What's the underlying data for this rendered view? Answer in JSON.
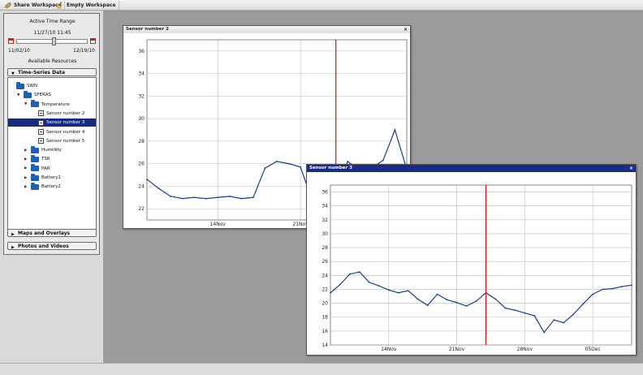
{
  "toolbar": {
    "share_label": "Share Workspace",
    "empty_label": "Empty Workspace"
  },
  "time_range": {
    "title": "Active Time Range",
    "current": "11/27/10 11:45",
    "min": "11/02/10",
    "max": "12/19/10",
    "position_fraction": 0.53
  },
  "resources": {
    "title": "Available Resources",
    "sections": [
      "Time-Series Data",
      "Maps and Overlays",
      "Photos and Videos"
    ],
    "tree": [
      {
        "label": "SWN",
        "level": 0,
        "kind": "folder",
        "expanded": true
      },
      {
        "label": "SFERAS",
        "level": 1,
        "kind": "folder",
        "expanded": true
      },
      {
        "label": "Temperature",
        "level": 2,
        "kind": "folder",
        "expanded": true
      },
      {
        "label": "Sensor number 2",
        "level": 3,
        "kind": "sensor"
      },
      {
        "label": "Sensor number 3",
        "level": 3,
        "kind": "sensor",
        "selected": true
      },
      {
        "label": "Sensor number 4",
        "level": 3,
        "kind": "sensor"
      },
      {
        "label": "Sensor number 5",
        "level": 3,
        "kind": "sensor"
      },
      {
        "label": "Humidity",
        "level": 2,
        "kind": "folder"
      },
      {
        "label": "TSR",
        "level": 2,
        "kind": "folder"
      },
      {
        "label": "PAR",
        "level": 2,
        "kind": "folder"
      },
      {
        "label": "Battery1",
        "level": 2,
        "kind": "folder"
      },
      {
        "label": "Battery2",
        "level": 2,
        "kind": "folder"
      }
    ]
  },
  "colors": {
    "series": "#1a3f8f",
    "cursor": "#e01010",
    "selected_row": "#1a2a7a",
    "folder": "#1f5fb5"
  },
  "chart_data": [
    {
      "type": "line",
      "window_title": "Sensor number 2",
      "x_range": [
        "2010-11-08",
        "2010-11-30"
      ],
      "ylim": [
        21,
        37
      ],
      "yticks": [
        22,
        24,
        26,
        28,
        30,
        32,
        34,
        36
      ],
      "xtick_labels": [
        "14Nov",
        "21Nov"
      ],
      "xtick_dates": [
        "2010-11-14",
        "2010-11-21"
      ],
      "cursor_date": "2010-11-24",
      "grid": true,
      "points": [
        [
          "2010-11-08",
          24.6
        ],
        [
          "2010-11-09",
          23.8
        ],
        [
          "2010-11-10",
          23.1
        ],
        [
          "2010-11-11",
          22.9
        ],
        [
          "2010-11-12",
          23.0
        ],
        [
          "2010-11-13",
          22.9
        ],
        [
          "2010-11-14",
          23.0
        ],
        [
          "2010-11-15",
          23.1
        ],
        [
          "2010-11-16",
          22.9
        ],
        [
          "2010-11-17",
          23.0
        ],
        [
          "2010-11-18",
          25.6
        ],
        [
          "2010-11-19",
          26.2
        ],
        [
          "2010-11-20",
          26.0
        ],
        [
          "2010-11-21",
          25.7
        ],
        [
          "2010-11-22",
          22.7
        ],
        [
          "2010-11-23",
          23.0
        ],
        [
          "2010-11-24",
          23.4
        ],
        [
          "2010-11-25",
          26.2
        ],
        [
          "2010-11-26",
          25.4
        ],
        [
          "2010-11-27",
          25.6
        ],
        [
          "2010-11-28",
          26.3
        ],
        [
          "2010-11-29",
          29.0
        ],
        [
          "2010-11-30",
          25.5
        ]
      ]
    },
    {
      "type": "line",
      "window_title": "Sensor number 3",
      "x_range": [
        "2010-11-08",
        "2010-12-09"
      ],
      "ylim": [
        14,
        37
      ],
      "yticks": [
        14,
        16,
        18,
        20,
        22,
        24,
        26,
        28,
        30,
        32,
        34,
        36
      ],
      "xtick_labels": [
        "14Nov",
        "21Nov",
        "28Nov",
        "05Dec"
      ],
      "xtick_dates": [
        "2010-11-14",
        "2010-11-21",
        "2010-11-28",
        "2010-12-05"
      ],
      "cursor_date": "2010-11-24",
      "grid": true,
      "points": [
        [
          "2010-11-08",
          21.5
        ],
        [
          "2010-11-09",
          22.7
        ],
        [
          "2010-11-10",
          24.2
        ],
        [
          "2010-11-11",
          24.5
        ],
        [
          "2010-11-12",
          23.0
        ],
        [
          "2010-11-13",
          22.5
        ],
        [
          "2010-11-14",
          21.9
        ],
        [
          "2010-11-15",
          21.5
        ],
        [
          "2010-11-16",
          21.8
        ],
        [
          "2010-11-17",
          20.6
        ],
        [
          "2010-11-18",
          19.7
        ],
        [
          "2010-11-19",
          21.3
        ],
        [
          "2010-11-20",
          20.5
        ],
        [
          "2010-11-21",
          20.1
        ],
        [
          "2010-11-22",
          19.6
        ],
        [
          "2010-11-23",
          20.3
        ],
        [
          "2010-11-24",
          21.5
        ],
        [
          "2010-11-25",
          20.6
        ],
        [
          "2010-11-26",
          19.3
        ],
        [
          "2010-11-27",
          19.0
        ],
        [
          "2010-11-28",
          18.6
        ],
        [
          "2010-11-29",
          18.2
        ],
        [
          "2010-11-30",
          15.8
        ],
        [
          "2010-12-01",
          17.6
        ],
        [
          "2010-12-02",
          17.2
        ],
        [
          "2010-12-03",
          18.4
        ],
        [
          "2010-12-04",
          19.9
        ],
        [
          "2010-12-05",
          21.3
        ],
        [
          "2010-12-06",
          22.0
        ],
        [
          "2010-12-07",
          22.1
        ],
        [
          "2010-12-08",
          22.4
        ],
        [
          "2010-12-09",
          22.6
        ]
      ]
    }
  ]
}
